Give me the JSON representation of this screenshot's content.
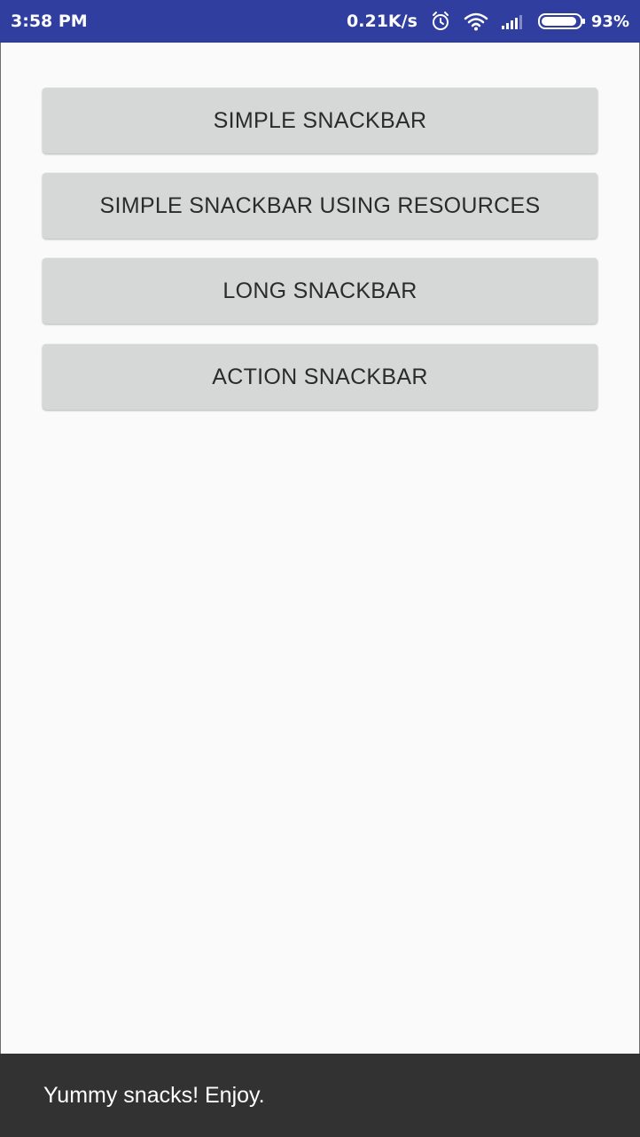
{
  "status_bar": {
    "time": "3:58 PM",
    "net_speed": "0.21K/s",
    "battery": "93%",
    "battery_level": 0.93,
    "icons": [
      "alarm-icon",
      "wifi-icon",
      "signal-icon",
      "battery-icon"
    ],
    "background": "#303f9f"
  },
  "buttons": [
    {
      "label": "SIMPLE SNACKBAR"
    },
    {
      "label": "SIMPLE SNACKBAR USING RESOURCES"
    },
    {
      "label": "LONG SNACKBAR"
    },
    {
      "label": "ACTION SNACKBAR"
    }
  ],
  "snackbar": {
    "message": "Yummy snacks! Enjoy."
  },
  "colors": {
    "button_background": "#d6d7d7",
    "page_background": "#fafafa",
    "snackbar_background": "#323232"
  }
}
